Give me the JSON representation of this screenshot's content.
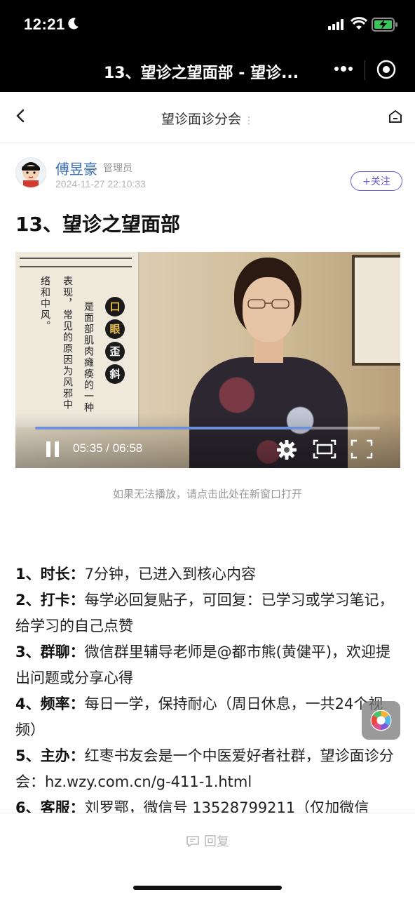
{
  "status_bar": {
    "time": "12:21"
  },
  "wechat_bar": {
    "title": "13、望诊之望面部 - 望诊..."
  },
  "forum": {
    "title": "望诊面诊分会",
    "title_suffix": "⋮"
  },
  "post": {
    "author": "傅昱豪",
    "role": "管理员",
    "time": "2024-11-27 22:10:33",
    "follow_label": "+关注",
    "title": "13、望诊之望面部"
  },
  "video": {
    "caption_seals": [
      "口",
      "眼",
      "歪",
      "斜"
    ],
    "caption_col1": "是面部肌肉瘫痪的一种",
    "caption_col2": "表现，常见的原因为风邪中",
    "caption_col3": "络和中风。",
    "time_display": "05:35 / 06:58",
    "progress": 0.803,
    "hint": "如果无法播放，请点击此处在新窗口打开"
  },
  "content": {
    "items": [
      {
        "label": "1、时长：",
        "text": "7分钟，已进入到核心内容"
      },
      {
        "label": "2、打卡：",
        "text": "每学必回复贴子，可回复：已学习或学习笔记，给学习的自己点赞"
      },
      {
        "label": "3、群聊：",
        "text": "微信群里辅导老师是@都市熊(黄健平)，欢迎提出问题或分享心得"
      },
      {
        "label": "4、频率：",
        "text": "每日一学，保持耐心（周日休息，一共24个视频）"
      },
      {
        "label": "5、主办：",
        "text": "红枣书友会是一个中医爱好者社群，望诊面诊分会：hz.wzy.com.cn/g-411-1.html"
      },
      {
        "label": "6、客服：",
        "text": "刘罗鄂，微信号 13528799211（仅加微信"
      }
    ]
  },
  "reply": {
    "label": "回复"
  },
  "colors": {
    "accent": "#6b5bd6",
    "link": "#3a6fb5",
    "progress": "#6e8fd8"
  }
}
